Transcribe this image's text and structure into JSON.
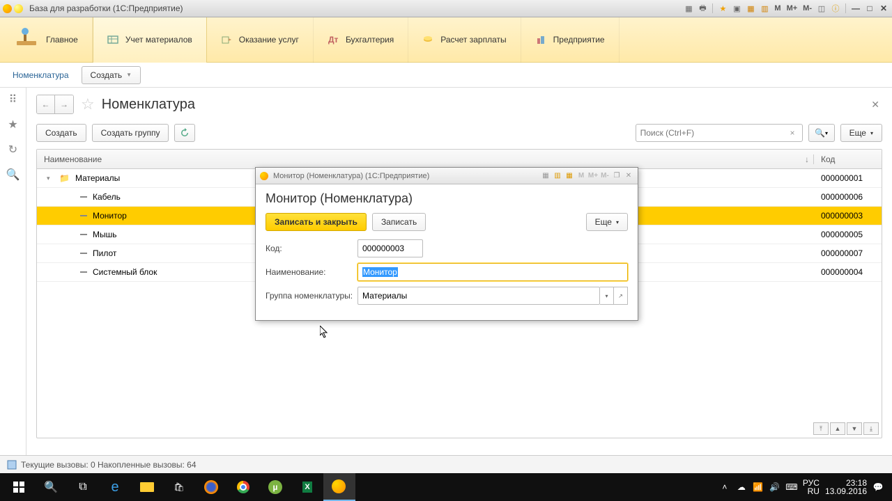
{
  "window": {
    "title": "База для разработки  (1С:Предприятие)",
    "m_labels": [
      "M",
      "M+",
      "M-"
    ]
  },
  "nav": {
    "items": [
      "Главное",
      "Учет материалов",
      "Оказание услуг",
      "Бухгалтерия",
      "Расчет зарплаты",
      "Предприятие"
    ]
  },
  "subbar": {
    "breadcrumb": "Номенклатура",
    "create": "Создать"
  },
  "page": {
    "title": "Номенклатура"
  },
  "toolbar": {
    "create": "Создать",
    "create_group": "Создать группу",
    "search_placeholder": "Поиск (Ctrl+F)",
    "more": "Еще"
  },
  "table": {
    "col_name": "Наименование",
    "col_code": "Код",
    "rows": [
      {
        "type": "folder",
        "indent": 1,
        "name": "Материалы",
        "code": "000000001",
        "sel": false
      },
      {
        "type": "item",
        "indent": 2,
        "name": "Кабель",
        "code": "000000006",
        "sel": false
      },
      {
        "type": "item",
        "indent": 2,
        "name": "Монитор",
        "code": "000000003",
        "sel": true
      },
      {
        "type": "item",
        "indent": 2,
        "name": "Мышь",
        "code": "000000005",
        "sel": false
      },
      {
        "type": "item",
        "indent": 2,
        "name": "Пилот",
        "code": "000000007",
        "sel": false
      },
      {
        "type": "item",
        "indent": 2,
        "name": "Системный блок",
        "code": "000000004",
        "sel": false
      }
    ]
  },
  "dialog": {
    "titlebar": "Монитор (Номенклатура)  (1С:Предприятие)",
    "heading": "Монитор (Номенклатура)",
    "save_close": "Записать и закрыть",
    "save": "Записать",
    "more": "Еще",
    "lbl_code": "Код:",
    "val_code": "000000003",
    "lbl_name": "Наименование:",
    "val_name": "Монитор",
    "lbl_group": "Группа номенклатуры:",
    "val_group": "Материалы"
  },
  "status": {
    "text": "Текущие вызовы: 0  Накопленные вызовы: 64"
  },
  "clock": {
    "lang": "РУС",
    "kb": "RU",
    "time": "23:18",
    "date": "13.09.2016"
  }
}
